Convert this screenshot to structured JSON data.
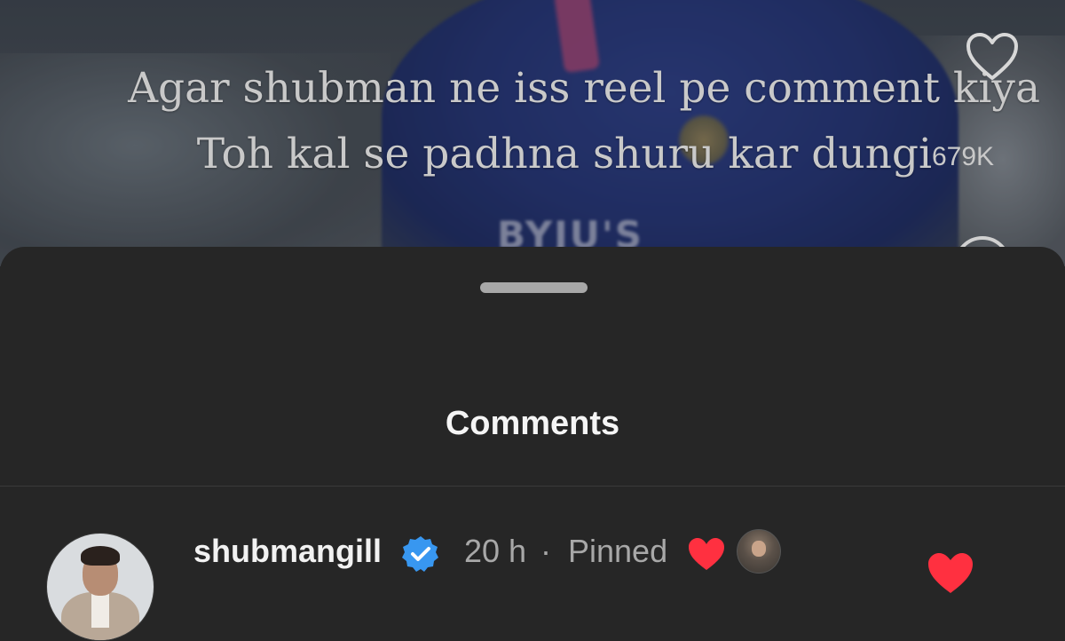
{
  "reel": {
    "caption_line1": "Agar shubman ne iss reel pe comment kiya",
    "caption_line2": "Toh kal se padhna shuru kar dungi",
    "like_count": "679K",
    "like_icon": "heart-outline-icon",
    "sponsor_text": "BYJU'S"
  },
  "sheet": {
    "title": "Comments"
  },
  "comment": {
    "username": "shubmangill",
    "verified_icon": "verified-badge-icon",
    "time": "20 h",
    "separator": "·",
    "pinned_label": "Pinned",
    "creator_liked_icon": "red-heart-icon",
    "like_icon": "heart-filled-icon"
  },
  "colors": {
    "sheet_bg": "#262626",
    "heart_red": "#ff3040",
    "verified_blue": "#3897f0",
    "muted_text": "#a8a8a8"
  }
}
